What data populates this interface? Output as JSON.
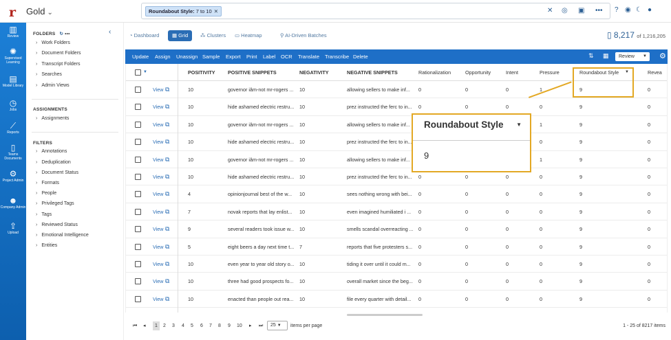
{
  "app": {
    "project": "Gold"
  },
  "search": {
    "chip_label": "Roundabout Style:",
    "chip_value": "7 to 10"
  },
  "nav": [
    {
      "label": "Review",
      "icon": "bar-chart-icon"
    },
    {
      "label": "Supervised Learning",
      "icon": "lightbulb-icon"
    },
    {
      "label": "Model Library",
      "icon": "library-icon"
    },
    {
      "label": "Jobs",
      "icon": "clock-icon"
    },
    {
      "label": "Reports",
      "icon": "line-chart-icon"
    },
    {
      "label": "Teams Documents",
      "icon": "document-icon"
    },
    {
      "label": "Project Admin",
      "icon": "gear-icon"
    },
    {
      "label": "Company Admin",
      "icon": "users-icon"
    },
    {
      "label": "Upload",
      "icon": "upload-icon"
    }
  ],
  "sidebar": {
    "folders_title": "FOLDERS",
    "folders": [
      "Work Folders",
      "Document Folders",
      "Transcript Folders",
      "Searches",
      "Admin Views"
    ],
    "assignments_title": "ASSIGNMENTS",
    "assignments": [
      "Assignments"
    ],
    "filters_title": "FILTERS",
    "filters": [
      "Annotations",
      "Deduplication",
      "Document Status",
      "Formats",
      "People",
      "Privileged Tags",
      "Tags",
      "Reviewed Status",
      "Emotional Intelligence",
      "Entities"
    ]
  },
  "views": {
    "dashboard": "Dashboard",
    "grid": "Grid",
    "clusters": "Clusters",
    "heatmap": "Heatmap",
    "ai_batches": "AI-Driven Batches"
  },
  "count": {
    "value": "8,217",
    "total": "of 1,216,205"
  },
  "toolbar": {
    "buttons": [
      "Update",
      "Assign",
      "Unassign",
      "Sample",
      "Export",
      "Print",
      "Label",
      "OCR",
      "Translate",
      "Transcribe",
      "Delete"
    ],
    "review_select": "Review"
  },
  "table": {
    "columns": [
      "POSITIVITY",
      "POSITIVE SNIPPETS",
      "NEGATIVITY",
      "NEGATIVE SNIPPETS",
      "Rationalization",
      "Opportunity",
      "Intent",
      "Pressure",
      "Roundabout Style",
      "Revea"
    ],
    "view_label": "View",
    "rows": [
      [
        "10",
        "governor iâm-not mr-rogers ...",
        "10",
        "allowing sellers to make inf...",
        "0",
        "0",
        "0",
        "1",
        "9",
        "0"
      ],
      [
        "10",
        "hide ashamed electric restru...",
        "10",
        "prez instructed the ferc to in...",
        "0",
        "0",
        "0",
        "0",
        "9",
        "0"
      ],
      [
        "10",
        "governor iâm-not mr-rogers ...",
        "10",
        "allowing sellers to make inf...",
        "0",
        "0",
        "0",
        "1",
        "9",
        "0"
      ],
      [
        "10",
        "hide ashamed electric restru...",
        "10",
        "prez instructed the ferc to in...",
        "0",
        "0",
        "0",
        "0",
        "9",
        "0"
      ],
      [
        "10",
        "governor iâm-not mr-rogers ...",
        "10",
        "allowing sellers to make inf...",
        "0",
        "0",
        "0",
        "1",
        "9",
        "0"
      ],
      [
        "10",
        "hide ashamed electric restru...",
        "10",
        "prez instructed the ferc to in...",
        "0",
        "0",
        "0",
        "0",
        "9",
        "0"
      ],
      [
        "4",
        "opinionjournal best of the w...",
        "10",
        "sees nothing wrong with bei...",
        "0",
        "0",
        "0",
        "0",
        "9",
        "0"
      ],
      [
        "7",
        "novak reports that lay enlist...",
        "10",
        "even imagined humiliated i ...",
        "0",
        "0",
        "0",
        "0",
        "9",
        "0"
      ],
      [
        "9",
        "several readers took issue w...",
        "10",
        "smells scandal overreacting ...",
        "0",
        "0",
        "0",
        "0",
        "9",
        "0"
      ],
      [
        "5",
        "eight beers a day next time t...",
        "7",
        "reports that five protesters s...",
        "0",
        "0",
        "0",
        "0",
        "9",
        "0"
      ],
      [
        "10",
        "even year to year old story o...",
        "10",
        "tiding it over until it could m...",
        "0",
        "0",
        "0",
        "0",
        "9",
        "0"
      ],
      [
        "10",
        "three had good prospects fo...",
        "10",
        "overall market since the beg...",
        "0",
        "0",
        "0",
        "0",
        "9",
        "0"
      ],
      [
        "10",
        "enacted than people out rea...",
        "10",
        "file every quarter with detail...",
        "0",
        "0",
        "0",
        "0",
        "9",
        "0"
      ]
    ]
  },
  "callout": {
    "title": "Roundabout Style",
    "value": "9"
  },
  "pager": {
    "pages": [
      "1",
      "2",
      "3",
      "4",
      "5",
      "6",
      "7",
      "8",
      "9",
      "10"
    ],
    "per_page": "25",
    "per_page_label": "items per page",
    "range": "1 - 25 of 8217 items"
  }
}
